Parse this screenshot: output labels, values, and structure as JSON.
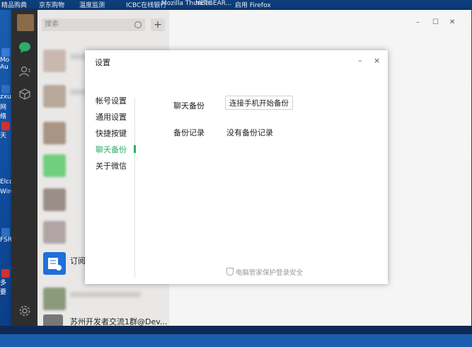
{
  "desktop": {
    "top_labels": [
      "精品购典",
      "京东购物",
      "温度监测",
      "ICBC在线银行",
      "Mozilla Thunder",
      "NETGEAR...",
      "启用 Firefox"
    ],
    "side_labels": [
      "Mo",
      "Au",
      "zxu",
      "网络",
      "天",
      "Elco",
      "Wire",
      "FSRe",
      "多要"
    ]
  },
  "wechat": {
    "search_placeholder": "搜索",
    "plus_label": "+",
    "chat_items": [
      {
        "name": ""
      },
      {
        "name": ""
      },
      {
        "name": ""
      },
      {
        "name": ""
      },
      {
        "name": ""
      },
      {
        "name": ""
      },
      {
        "name": "订阅"
      },
      {
        "name": ""
      },
      {
        "name": "苏州开发者交流1群@Dev..."
      }
    ],
    "window_controls": [
      "–",
      "☐",
      "✕"
    ],
    "colors": {
      "nav_bg": "#2e2e2e",
      "accent": "#2aae67"
    }
  },
  "settings": {
    "title": "设置",
    "minimize_label": "–",
    "close_label": "×",
    "menu": [
      "帐号设置",
      "通用设置",
      "快捷按键",
      "聊天备份",
      "关于微信"
    ],
    "active_menu": "聊天备份",
    "rows": {
      "backup_label": "聊天备份",
      "backup_button": "连接手机开始备份",
      "record_label": "备份记录",
      "record_value": "没有备份记录"
    },
    "footer": "电脑管家保护登录安全"
  }
}
